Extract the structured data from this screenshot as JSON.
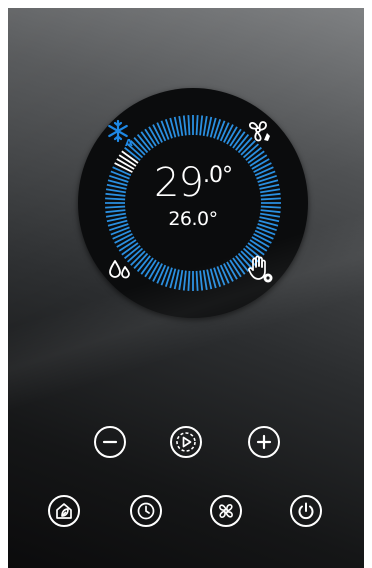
{
  "thermostat": {
    "current_temp_int": "29",
    "current_temp_dec": ".0°",
    "set_temp": "26.0°",
    "active_mode": "auto-cool",
    "accent_color": "#1e88e5",
    "ring_color": "#2a8fe0"
  },
  "mode_icons": {
    "top_left": "snowflake-auto-icon",
    "top_right": "fan-icon",
    "bottom_left": "drops-icon",
    "bottom_right": "manual-hand-icon"
  },
  "controls_row1": [
    "minus-icon",
    "play-icon",
    "plus-icon"
  ],
  "controls_row2": [
    "home-leaf-icon",
    "clock-icon",
    "fan-icon",
    "power-icon"
  ]
}
